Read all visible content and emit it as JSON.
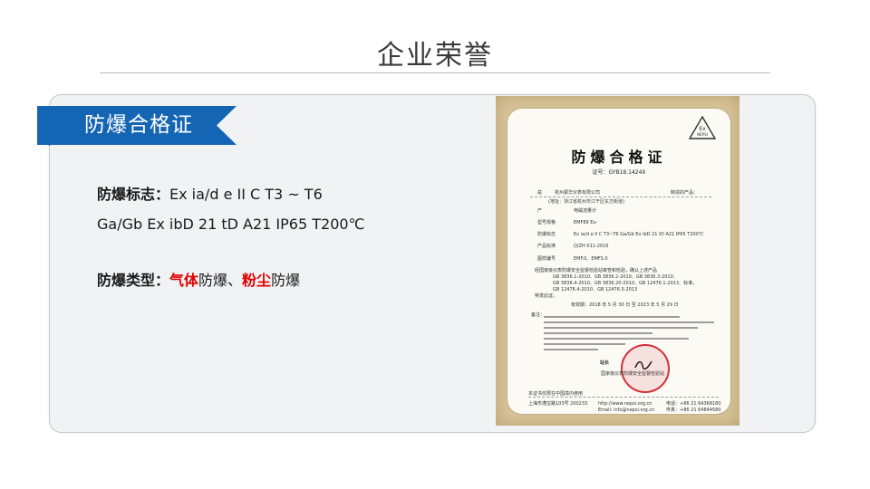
{
  "page": {
    "title": "企业荣誉"
  },
  "section": {
    "ribbon_label": "防爆合格证"
  },
  "info": {
    "mark_label": "防爆标志：",
    "mark_value": "Ex ia/d e II C T3 ~ T6",
    "mark_value_line2": "Ga/Gb Ex ibD 21 tD A21 IP65 T200℃",
    "type_label": "防爆类型：",
    "type_gas": "气体",
    "type_part1": "防爆、",
    "type_dust": "粉尘",
    "type_part2": "防爆"
  },
  "certificate": {
    "title": "防爆合格证",
    "number": "证号：GYB18.1424X",
    "logo_text": "Ex NEPSI",
    "applicant_label": "兹",
    "applicant": "杭州振华仪表有限公司",
    "produced_label": "制造的产品：",
    "address": "(地址：浙江省杭州市江干区东方街道)",
    "product_name_label": "产",
    "product_name": "电磁流量计",
    "model_label": "型号规格",
    "model": "EMF89 Ex-",
    "mark_label": "防爆标志",
    "mark": "Ex ia/d e II C T3~T6 Ga/Gb   Ex ibD 21 tD A21 IP65 T200℃",
    "standard_label": "产品标准",
    "standard": "Q/ZH 011-2016",
    "drawing_label": "图样编号",
    "drawing": "EMF.0、EMFS.0",
    "body1": "经国家级仪表防爆安全监督检验站审查和检验，确认上述产品",
    "body2": "GB 3836.1-2010、GB 3836.2-2010、GB 3836.3-2010、",
    "body3": "GB 3836.4-2010、GB 3836.20-2010、GB 12476.1-2013、标准，",
    "body4": "GB 12476.4-2010、GB 12476.5-2013",
    "issue_label": "特发此证。",
    "validity": "有效期：2018 年 5 月 30 日 至 2023 年 5 月 29 日",
    "notes_title": "备注：",
    "director_label": "站长",
    "station": "国家级仪表防爆安全监督检验站",
    "footer_left": "本证书仅限在中国境内使用",
    "footer_address": "上海市漕宝路103号 200233",
    "footer_web": "http://www.nepsi.org.cn",
    "footer_email": "Email: info@nepsi.org.cn",
    "footer_tel": "电话：+86 21 64368180",
    "footer_fax": "传真：+86 21 64844580"
  }
}
